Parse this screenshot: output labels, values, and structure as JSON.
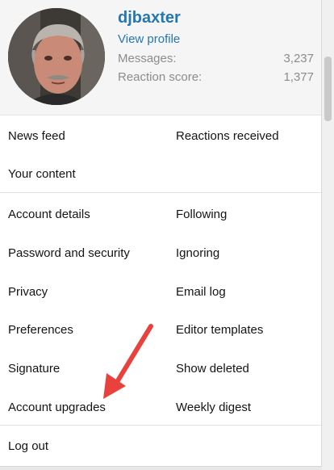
{
  "profile": {
    "username": "djbaxter",
    "view_profile": "View profile",
    "messages_label": "Messages:",
    "messages_value": "3,237",
    "reaction_label": "Reaction score:",
    "reaction_value": "1,377"
  },
  "section1": {
    "news_feed": "News feed",
    "reactions_received": "Reactions received",
    "your_content": "Your content"
  },
  "section2": {
    "account_details": "Account details",
    "following": "Following",
    "password_security": "Password and security",
    "ignoring": "Ignoring",
    "privacy": "Privacy",
    "email_log": "Email log",
    "preferences": "Preferences",
    "editor_templates": "Editor templates",
    "signature": "Signature",
    "show_deleted": "Show deleted",
    "account_upgrades": "Account upgrades",
    "weekly_digest": "Weekly digest"
  },
  "section3": {
    "log_out": "Log out"
  },
  "colors": {
    "link": "#2577b1",
    "annotation_arrow": "#e8413e"
  }
}
